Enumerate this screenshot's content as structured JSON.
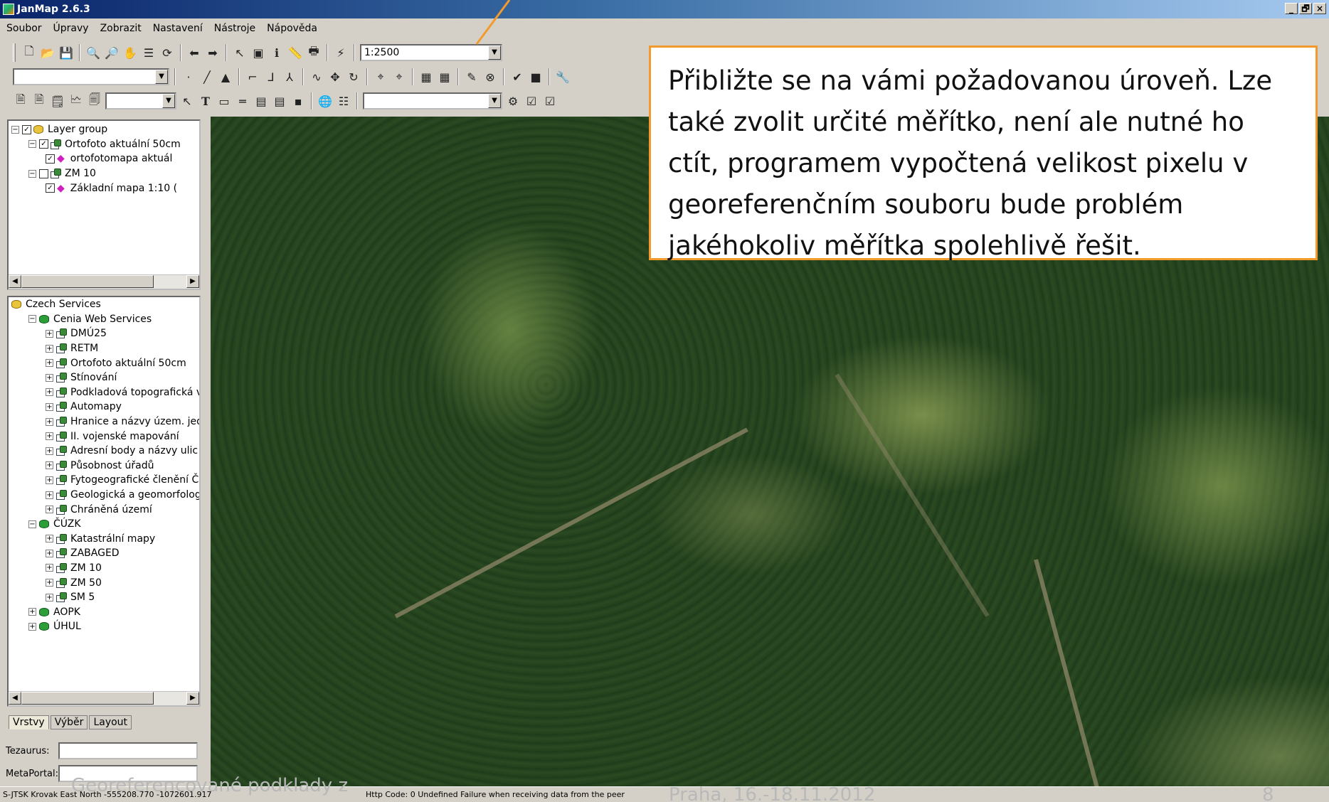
{
  "window": {
    "title": "JanMap 2.6.3",
    "controls": [
      "_",
      "🗗",
      "×"
    ]
  },
  "menu": [
    "Soubor",
    "Úpravy",
    "Zobrazit",
    "Nastavení",
    "Nástroje",
    "Nápověda"
  ],
  "toolbar": {
    "scale_value": "1:2500"
  },
  "layers": [
    {
      "level": 0,
      "expand": "−",
      "check": "✓",
      "icon": "db-yellow",
      "label": "Layer group"
    },
    {
      "level": 1,
      "expand": "−",
      "check": "✓",
      "icon": "layer",
      "label": "Ortofoto aktuální 50cm"
    },
    {
      "level": 2,
      "check": "✓",
      "icon": "diamond",
      "label": "ortofotomapa aktuál"
    },
    {
      "level": 1,
      "expand": "−",
      "check": "",
      "icon": "layer",
      "label": "ZM 10"
    },
    {
      "level": 2,
      "check": "✓",
      "icon": "diamond",
      "label": "Základní mapa 1:10 ("
    }
  ],
  "services": [
    {
      "level": 0,
      "icon": "db-yellow",
      "label": "Czech Services"
    },
    {
      "level": 1,
      "expand": "−",
      "icon": "db",
      "label": "Cenia Web Services"
    },
    {
      "level": 2,
      "expand": "+",
      "icon": "layer",
      "label": "DMÚ25"
    },
    {
      "level": 2,
      "expand": "+",
      "icon": "layer",
      "label": "RETM"
    },
    {
      "level": 2,
      "expand": "+",
      "icon": "layer",
      "label": "Ortofoto aktuální 50cm"
    },
    {
      "level": 2,
      "expand": "+",
      "icon": "layer",
      "label": "Stínování"
    },
    {
      "level": 2,
      "expand": "+",
      "icon": "layer",
      "label": "Podkladová topografická vı"
    },
    {
      "level": 2,
      "expand": "+",
      "icon": "layer",
      "label": "Automapy"
    },
    {
      "level": 2,
      "expand": "+",
      "icon": "layer",
      "label": "Hranice a názvy územ. jedı"
    },
    {
      "level": 2,
      "expand": "+",
      "icon": "layer",
      "label": "II. vojenské mapování"
    },
    {
      "level": 2,
      "expand": "+",
      "icon": "layer",
      "label": "Adresní body a názvy ulic"
    },
    {
      "level": 2,
      "expand": "+",
      "icon": "layer",
      "label": "Působnost úřadů"
    },
    {
      "level": 2,
      "expand": "+",
      "icon": "layer",
      "label": "Fytogeografické členění ČF"
    },
    {
      "level": 2,
      "expand": "+",
      "icon": "layer",
      "label": "Geologická a geomorfologi"
    },
    {
      "level": 2,
      "expand": "+",
      "icon": "layer",
      "label": "Chráněná území"
    },
    {
      "level": 1,
      "expand": "−",
      "icon": "db",
      "label": "ČÚZK"
    },
    {
      "level": 2,
      "expand": "+",
      "icon": "layer",
      "label": "Katastrální mapy"
    },
    {
      "level": 2,
      "expand": "+",
      "icon": "layer",
      "label": "ZABAGED"
    },
    {
      "level": 2,
      "expand": "+",
      "icon": "layer",
      "label": "ZM 10"
    },
    {
      "level": 2,
      "expand": "+",
      "icon": "layer",
      "label": "ZM 50"
    },
    {
      "level": 2,
      "expand": "+",
      "icon": "layer",
      "label": "SM 5"
    },
    {
      "level": 1,
      "expand": "+",
      "icon": "db",
      "label": "AOPK"
    },
    {
      "level": 1,
      "expand": "+",
      "icon": "db",
      "label": "ÚHUL"
    }
  ],
  "tabs": [
    "Vrstvy",
    "Výběr",
    "Layout"
  ],
  "fields": {
    "tezaurus_label": "Tezaurus:",
    "metaportal_label": "MetaPortal:"
  },
  "callout": {
    "lines": [
      "Přibližte se na vámi požadovanou úroveň. Lze",
      "také zvolit určité měřítko, není ale nutné ho",
      "ctít, programem vypočtená velikost pixelu v",
      "georeferenčním souboru bude problém",
      "jakéhokoliv měřítka spolehlivě řešit."
    ],
    "border_color": "#f39a2c"
  },
  "status": {
    "coords": "S-JTSK Krovak East North  -555208.770  -1072601.917",
    "http": "Http Code: 0 Undefined  Failure when receiving data from the peer"
  },
  "footer": {
    "left": "Georeferencované podklady z",
    "mid": "Praha, 16.-18.11.2012",
    "page": "8"
  }
}
